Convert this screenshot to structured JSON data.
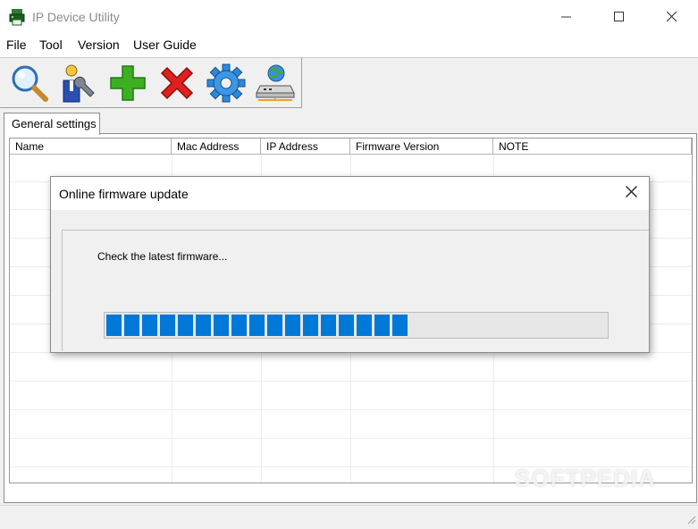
{
  "window": {
    "title": "IP Device Utility",
    "icons": {
      "app": "printer-app-icon",
      "minimize": "minimize-icon",
      "maximize": "maximize-icon",
      "close": "close-icon"
    }
  },
  "menu": [
    "File",
    "Tool",
    "Version",
    "User Guide"
  ],
  "toolbar": [
    {
      "name": "search-button",
      "icon": "magnifier-icon"
    },
    {
      "name": "settings-user-button",
      "icon": "user-wrench-icon"
    },
    {
      "name": "add-button",
      "icon": "green-plus-icon"
    },
    {
      "name": "delete-button",
      "icon": "red-x-icon"
    },
    {
      "name": "config-button",
      "icon": "blue-gear-icon"
    },
    {
      "name": "network-device-button",
      "icon": "network-device-icon"
    }
  ],
  "tabs": [
    {
      "label": "General settings",
      "selected": true
    }
  ],
  "table": {
    "columns": [
      "Name",
      "Mac Address",
      "IP Address",
      "Firmware Version",
      "NOTE"
    ],
    "rows": []
  },
  "dialog": {
    "title": "Online firmware update",
    "status": "Check the latest firmware...",
    "progress_percent": 60
  },
  "watermark": "SOFTPEDIA",
  "colors": {
    "progress": "#0078d7",
    "title_text": "#8a8a8a",
    "accent_green": "#3cb021",
    "accent_red": "#e0201f"
  }
}
